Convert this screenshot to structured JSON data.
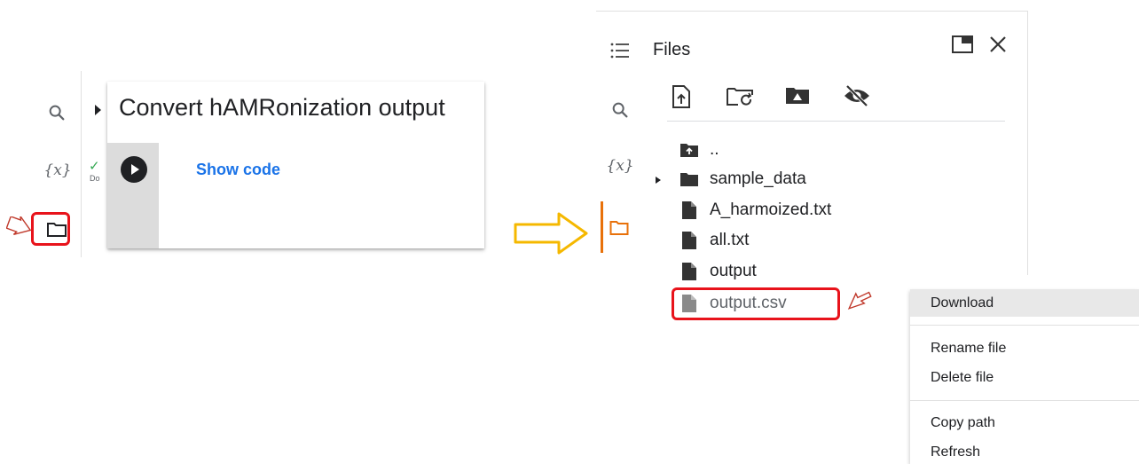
{
  "left_panel": {
    "icons": [
      "search-icon",
      "variables-icon",
      "folder-icon"
    ],
    "variables_glyph": "{x}",
    "cell": {
      "title": "Convert hAMRonization output",
      "show_code_label": "Show code",
      "status_check": "✓",
      "status_text": "Do"
    }
  },
  "right_panel": {
    "icons": [
      "menu-icon",
      "search-icon",
      "variables-icon",
      "folder-icon"
    ],
    "variables_glyph": "{x}",
    "header": {
      "title": "Files",
      "actions": [
        "open-in-new-window-icon",
        "close-icon"
      ]
    },
    "toolbar": [
      "upload-icon",
      "refresh-folder-icon",
      "mount-drive-icon",
      "toggle-hidden-icon"
    ],
    "tree": [
      {
        "label": "..",
        "kind": "parent-folder",
        "expandable": false
      },
      {
        "label": "sample_data",
        "kind": "folder",
        "expandable": true
      },
      {
        "label": "A_harmoized.txt",
        "kind": "file",
        "expandable": false
      },
      {
        "label": "all.txt",
        "kind": "file",
        "expandable": false
      },
      {
        "label": "output",
        "kind": "file",
        "expandable": false
      },
      {
        "label": "output.csv",
        "kind": "file",
        "expandable": false
      }
    ]
  },
  "context_menu": {
    "items": [
      {
        "label": "Download",
        "highlighted": true
      },
      {
        "label": "Rename file",
        "highlighted": false
      },
      {
        "label": "Delete file",
        "highlighted": false
      },
      {
        "label": "Copy path",
        "highlighted": false
      },
      {
        "label": "Refresh",
        "highlighted": false
      }
    ]
  },
  "annotations": {
    "highlight_color": "#e8131b",
    "transition_arrow_color": "#f5b800",
    "active_tab_color": "#e8710a"
  }
}
